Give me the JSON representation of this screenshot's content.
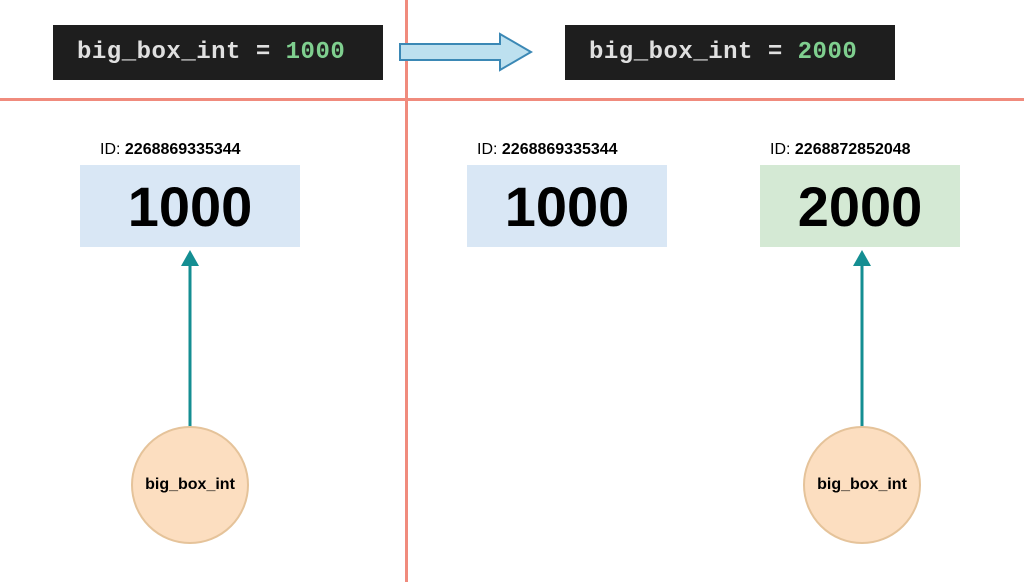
{
  "left_code": {
    "var": "big_box_int",
    "eq": " = ",
    "val": "1000"
  },
  "right_code": {
    "var": "big_box_int",
    "eq": " = ",
    "val": "2000"
  },
  "id_prefix": "ID: ",
  "objects": {
    "left_blue": {
      "id": "2268869335344",
      "value": "1000"
    },
    "right_blue": {
      "id": "2268869335344",
      "value": "1000"
    },
    "right_green": {
      "id": "2268872852048",
      "value": "2000"
    }
  },
  "var_label": "big_box_int",
  "colors": {
    "code_bg": "#1e1e1e",
    "num_color": "#7fcf8f",
    "line_color": "#f08b7d",
    "blue_box": "#d9e7f5",
    "green_box": "#d4e9d4",
    "circle_fill": "#fcdec0",
    "arrow_teal": "#148e92",
    "arrow_block_fill": "#bde0ef",
    "arrow_block_stroke": "#3b88b5"
  }
}
